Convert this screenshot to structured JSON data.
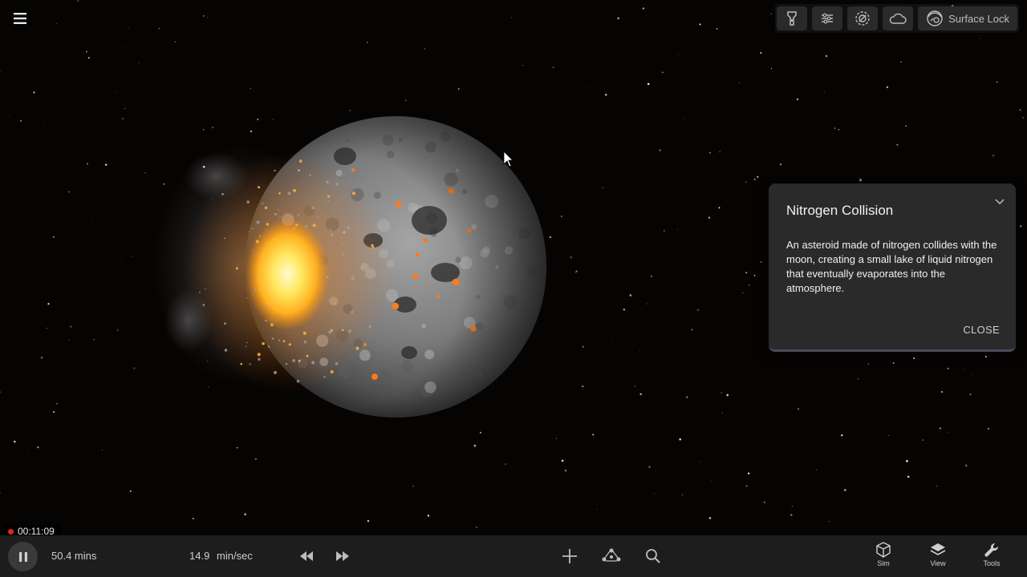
{
  "topbar": {
    "buttons": [
      {
        "icon": "flashlight-icon"
      },
      {
        "icon": "sliders-icon"
      },
      {
        "icon": "orbit-target-icon"
      },
      {
        "icon": "cloud-icon"
      }
    ],
    "surface_lock_icon": "surface-lock-icon",
    "surface_lock_label": "Surface Lock"
  },
  "menu_icon": "hamburger-menu-icon",
  "info_panel": {
    "title": "Nitrogen Collision",
    "body": "An asteroid made of nitrogen collides with the moon, creating a small lake of liquid nitrogen that eventually evaporates into the atmosphere.",
    "close_label": "CLOSE"
  },
  "recording": {
    "time": "00:11:09",
    "dot_color": "#e0261f"
  },
  "bottombar": {
    "elapsed": "50.4 mins",
    "speed_value": "14.9",
    "speed_unit": "min/sec",
    "tools": [
      {
        "icon": "cube-icon",
        "label": "Sim"
      },
      {
        "icon": "layers-icon",
        "label": "View"
      },
      {
        "icon": "wrench-icon",
        "label": "Tools"
      }
    ]
  }
}
